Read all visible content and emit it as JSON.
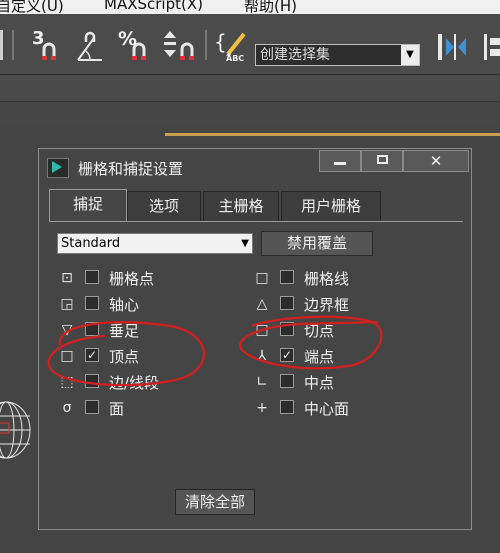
{
  "menubar": {
    "items": [
      "自定义(U)",
      "MAXScript(X)",
      "帮助(H)"
    ]
  },
  "toolbar": {
    "snap_3d_label": "3",
    "angle_snap_icon": "angle-snap-icon",
    "percent_snap_label": "%",
    "selection_set": "创建选择集",
    "abc_label": "ABC"
  },
  "dialog": {
    "title": "栅格和捕捉设置",
    "close_glyph": "✕",
    "tabs": [
      "捕捉",
      "选项",
      "主栅格",
      "用户栅格"
    ],
    "mode_value": "Standard",
    "override_button": "禁用覆盖",
    "clear_button": "清除全部",
    "left_items": [
      {
        "glyph": "⊡",
        "label": "栅格点",
        "checked": false
      },
      {
        "glyph": "◲",
        "label": "轴心",
        "checked": false
      },
      {
        "glyph": "▽",
        "label": "垂足",
        "checked": false
      },
      {
        "glyph": "□",
        "label": "顶点",
        "checked": true
      },
      {
        "glyph": "⬚",
        "label": "边/线段",
        "checked": false
      },
      {
        "glyph": "σ",
        "label": "面",
        "checked": false
      }
    ],
    "right_items": [
      {
        "glyph": "□",
        "label": "栅格线",
        "checked": false
      },
      {
        "glyph": "△",
        "label": "边界框",
        "checked": false
      },
      {
        "glyph": "□",
        "label": "切点",
        "checked": false
      },
      {
        "glyph": "⅄",
        "label": "端点",
        "checked": true
      },
      {
        "glyph": "∟",
        "label": "中点",
        "checked": false
      },
      {
        "glyph": "+",
        "label": "中心面",
        "checked": false
      }
    ]
  },
  "colors": {
    "annotation": "#d21f1f",
    "viewport_frame": "#c8a050"
  }
}
